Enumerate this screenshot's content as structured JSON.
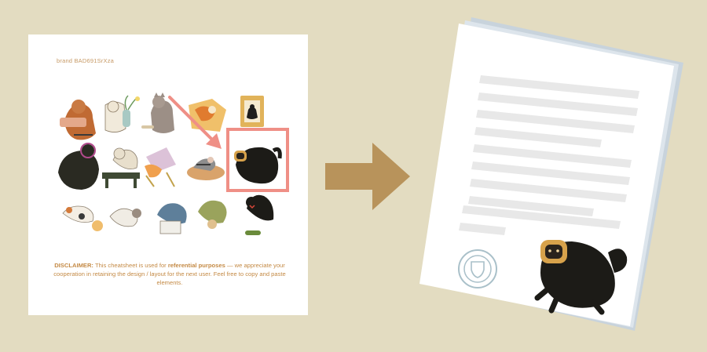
{
  "cheatsheet": {
    "brand_code": "brand BAD691SrXza",
    "disclaimer": {
      "label": "DISCLAIMER:",
      "text_1": " This cheatsheet is used for ",
      "emphasis": "referential purposes",
      "text_2": " — we appreciate your cooperation in retaining the design / layout for the next user. Feel free to copy and paste elements."
    }
  },
  "colors": {
    "background": "#e3dcc1",
    "arrow": "#b8935b",
    "highlight": "#ef8f86",
    "disclaimer_text": "#c48a45",
    "document_lines": "#e8e8e8",
    "stack_shadow": "#c8d3dc"
  },
  "icons": {
    "flow_arrow": "right-arrow-icon",
    "document_seal": "shield-seal-icon",
    "pointer_arrow": "diagonal-arrow-icon"
  }
}
